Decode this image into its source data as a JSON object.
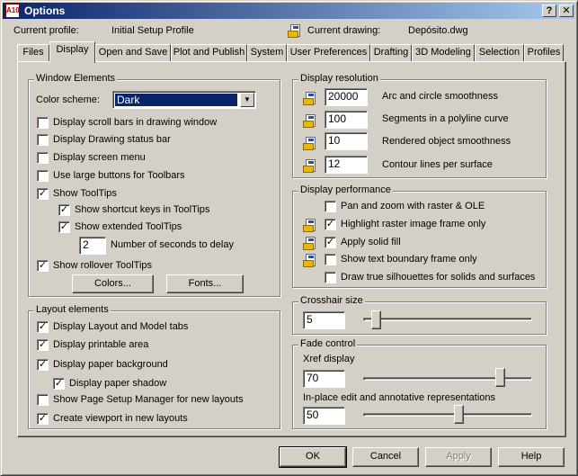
{
  "window": {
    "title": "Options",
    "app_icon_text": "A10",
    "buttons": {
      "help": "?",
      "close": "✕"
    }
  },
  "profile": {
    "label": "Current profile:",
    "value": "Initial Setup Profile",
    "drawing_label": "Current drawing:",
    "drawing_value": "Depósito.dwg"
  },
  "tabs": [
    "Files",
    "Display",
    "Open and Save",
    "Plot and Publish",
    "System",
    "User Preferences",
    "Drafting",
    "3D Modeling",
    "Selection",
    "Profiles"
  ],
  "active_tab": "Display",
  "window_elements": {
    "title": "Window Elements",
    "color_scheme_label": "Color scheme:",
    "color_scheme_value": "Dark",
    "items": [
      {
        "label": "Display scroll bars in drawing window",
        "checked": false
      },
      {
        "label": "Display Drawing status bar",
        "checked": false
      },
      {
        "label": "Display screen menu",
        "checked": false
      },
      {
        "label": "Use large buttons for Toolbars",
        "checked": false
      },
      {
        "label": "Show ToolTips",
        "checked": true
      },
      {
        "label": "Show shortcut keys in ToolTips",
        "checked": true
      },
      {
        "label": "Show extended ToolTips",
        "checked": true
      },
      {
        "label": "Show rollover ToolTips",
        "checked": true
      }
    ],
    "delay_value": "2",
    "delay_label": "Number of seconds to delay",
    "colors_button": "Colors...",
    "fonts_button": "Fonts..."
  },
  "layout_elements": {
    "title": "Layout elements",
    "items": [
      {
        "label": "Display Layout and Model tabs",
        "checked": true
      },
      {
        "label": "Display printable area",
        "checked": true
      },
      {
        "label": "Display paper background",
        "checked": true
      },
      {
        "label": "Display paper shadow",
        "checked": true
      },
      {
        "label": "Show Page Setup Manager for new layouts",
        "checked": false
      },
      {
        "label": "Create viewport in new layouts",
        "checked": true
      }
    ]
  },
  "display_resolution": {
    "title": "Display resolution",
    "items": [
      {
        "value": "20000",
        "label": "Arc and circle smoothness"
      },
      {
        "value": "100",
        "label": "Segments in a polyline curve"
      },
      {
        "value": "10",
        "label": "Rendered object smoothness"
      },
      {
        "value": "12",
        "label": "Contour lines per surface"
      }
    ]
  },
  "display_performance": {
    "title": "Display performance",
    "items": [
      {
        "label": "Pan and zoom with raster & OLE",
        "checked": false,
        "icon": false
      },
      {
        "label": "Highlight raster image frame only",
        "checked": true,
        "icon": true
      },
      {
        "label": "Apply solid fill",
        "checked": true,
        "icon": true
      },
      {
        "label": "Show text boundary frame only",
        "checked": false,
        "icon": true
      },
      {
        "label": "Draw true silhouettes for solids and surfaces",
        "checked": false,
        "icon": false
      }
    ]
  },
  "crosshair": {
    "title": "Crosshair size",
    "value": "5",
    "slider_fraction": 0.05
  },
  "fade_control": {
    "title": "Fade control",
    "xref_label": "Xref display",
    "xref_value": "70",
    "xref_fraction": 0.83,
    "inplace_label": "In-place edit and annotative representations",
    "inplace_value": "50",
    "inplace_fraction": 0.57
  },
  "footer": {
    "ok": "OK",
    "cancel": "Cancel",
    "apply": "Apply",
    "help": "Help"
  }
}
